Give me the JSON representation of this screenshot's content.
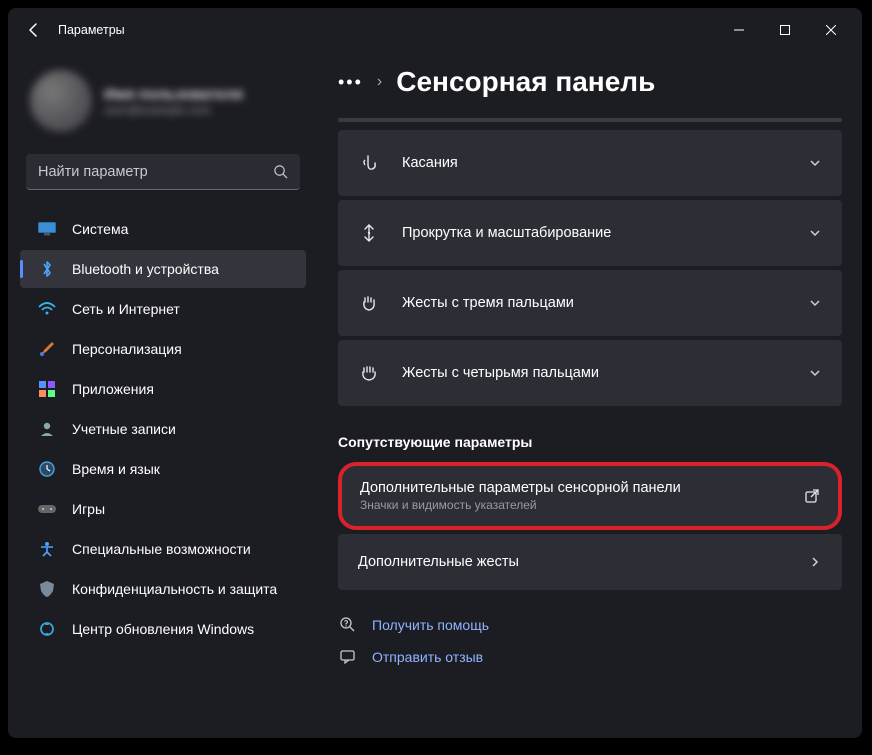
{
  "window": {
    "title": "Параметры"
  },
  "profile": {
    "name": "Имя пользователя",
    "email": "user@example.com"
  },
  "search": {
    "placeholder": "Найти параметр"
  },
  "nav": {
    "items": [
      {
        "label": "Система",
        "icon": "monitor"
      },
      {
        "label": "Bluetooth и устройства",
        "icon": "bluetooth",
        "active": true
      },
      {
        "label": "Сеть и Интернет",
        "icon": "wifi"
      },
      {
        "label": "Персонализация",
        "icon": "brush"
      },
      {
        "label": "Приложения",
        "icon": "apps"
      },
      {
        "label": "Учетные записи",
        "icon": "person"
      },
      {
        "label": "Время и язык",
        "icon": "clock"
      },
      {
        "label": "Игры",
        "icon": "gamepad"
      },
      {
        "label": "Специальные возможности",
        "icon": "accessibility"
      },
      {
        "label": "Конфиденциальность и защита",
        "icon": "shield"
      },
      {
        "label": "Центр обновления Windows",
        "icon": "update"
      }
    ]
  },
  "breadcrumb": {
    "title": "Сенсорная панель"
  },
  "options": [
    {
      "label": "Касания",
      "icon": "touch"
    },
    {
      "label": "Прокрутка и масштабирование",
      "icon": "scroll"
    },
    {
      "label": "Жесты с тремя пальцами",
      "icon": "hand3"
    },
    {
      "label": "Жесты с четырьмя пальцами",
      "icon": "hand4"
    }
  ],
  "related": {
    "heading": "Сопутствующие параметры",
    "items": [
      {
        "title": "Дополнительные параметры сенсорной панели",
        "subtitle": "Значки и видимость указателей",
        "action": "external",
        "highlighted": true
      },
      {
        "title": "Дополнительные жесты",
        "action": "chevron"
      }
    ]
  },
  "help": [
    {
      "label": "Получить помощь",
      "icon": "help"
    },
    {
      "label": "Отправить отзыв",
      "icon": "feedback"
    }
  ]
}
